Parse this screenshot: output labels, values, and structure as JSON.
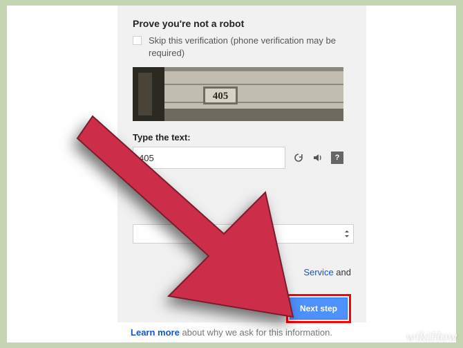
{
  "heading": "Prove you're not a robot",
  "skip": {
    "label": "Skip this verification (phone verification may be required)"
  },
  "captcha": {
    "image_number": "405",
    "type_label": "Type the text:",
    "input_value": "405"
  },
  "icons": {
    "reload": "↻",
    "audio": "🔊",
    "help": "?"
  },
  "tos": {
    "link_text": "Service",
    "after": " and"
  },
  "next_button": "Next step",
  "footer": {
    "link": "Learn more",
    "rest": " about why we ask for this information."
  },
  "watermark": "wikiHow"
}
